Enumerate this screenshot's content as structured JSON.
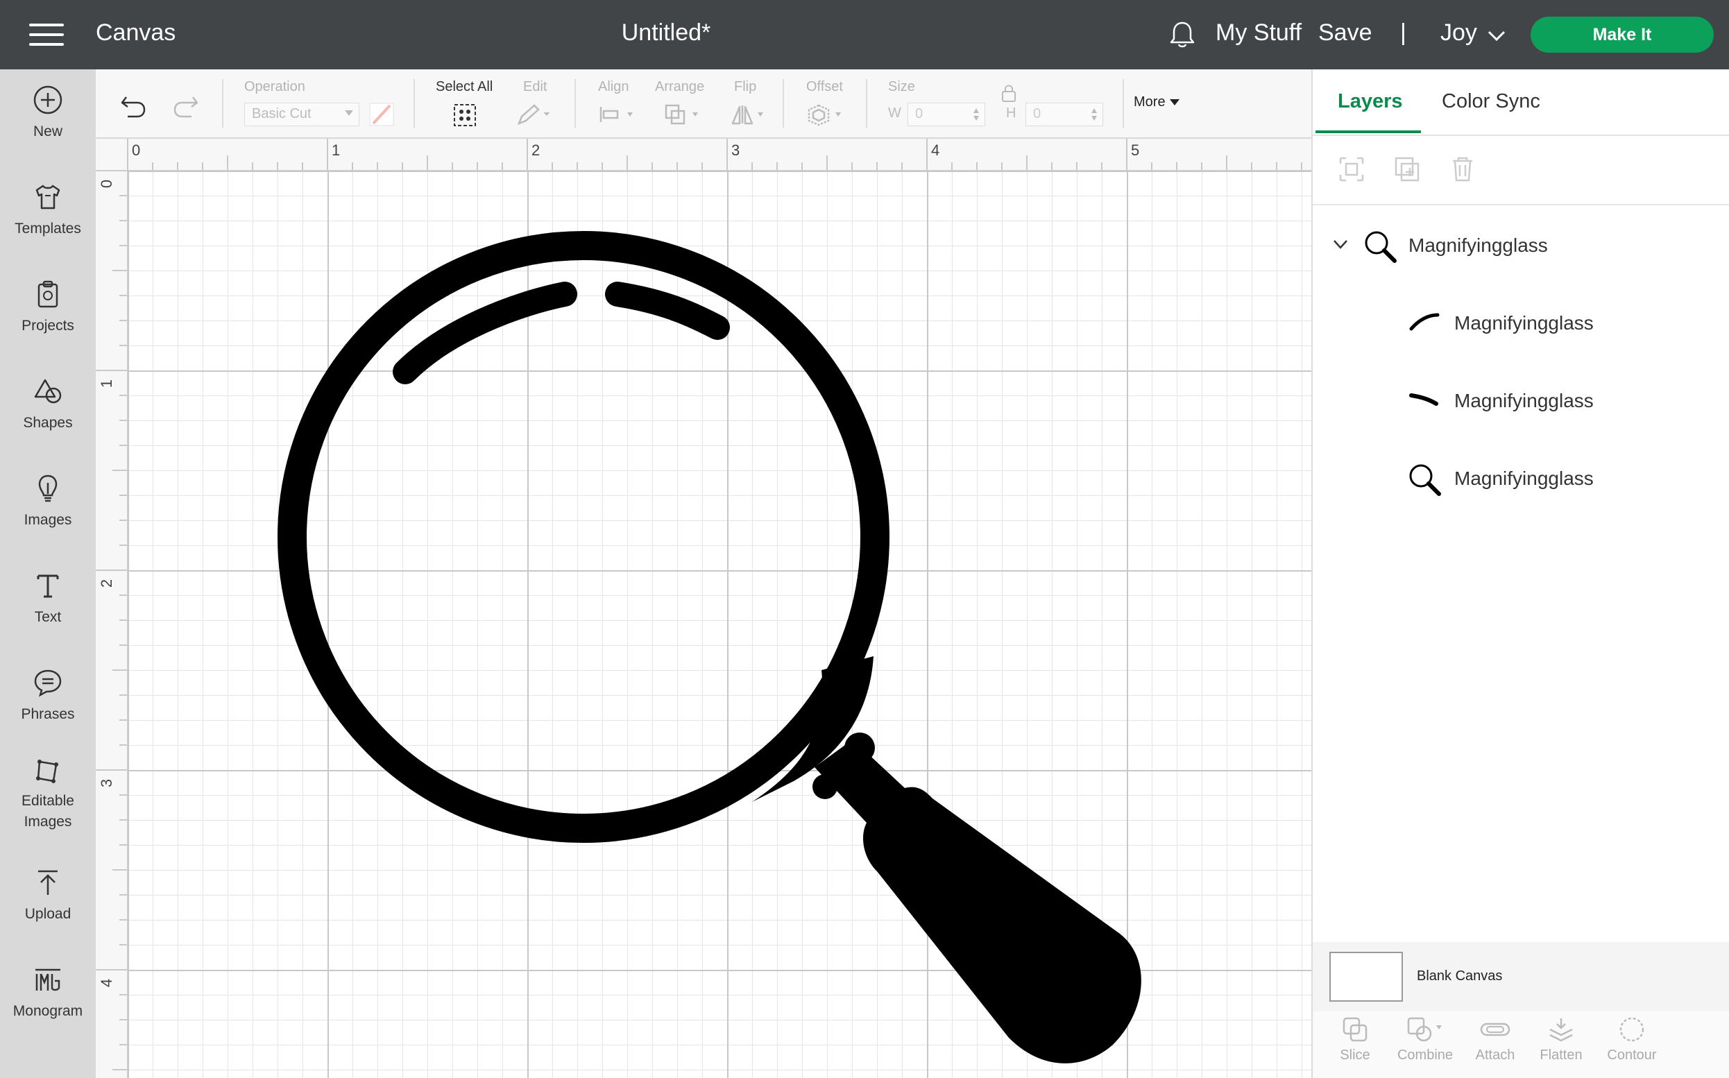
{
  "header": {
    "app_title": "Canvas",
    "document_title": "Untitled*",
    "my_stuff": "My Stuff",
    "save": "Save",
    "divider": "|",
    "user": "Joy",
    "make_it": "Make It"
  },
  "sidebar": {
    "items": [
      {
        "label": "New",
        "icon": "plus-circle-icon"
      },
      {
        "label": "Templates",
        "icon": "tshirt-icon"
      },
      {
        "label": "Projects",
        "icon": "clipboard-icon"
      },
      {
        "label": "Shapes",
        "icon": "shapes-icon"
      },
      {
        "label": "Images",
        "icon": "lightbulb-icon"
      },
      {
        "label": "Text",
        "icon": "text-t-icon"
      },
      {
        "label": "Phrases",
        "icon": "speech-bubble-icon"
      },
      {
        "label": "Editable\nImages",
        "label_line1": "Editable",
        "label_line2": "Images",
        "icon": "editable-images-icon"
      },
      {
        "label": "Upload",
        "icon": "upload-arrow-icon"
      },
      {
        "label": "Monogram",
        "icon": "monogram-icon"
      }
    ]
  },
  "toolbar": {
    "operation_label": "Operation",
    "operation_value": "Basic Cut",
    "select_all": "Select All",
    "edit": "Edit",
    "align": "Align",
    "arrange": "Arrange",
    "flip": "Flip",
    "offset": "Offset",
    "size": "Size",
    "w_label": "W",
    "w_value": "0",
    "h_label": "H",
    "h_value": "0",
    "more": "More"
  },
  "rulers": {
    "top": [
      "0",
      "1",
      "2",
      "3",
      "4",
      "5"
    ],
    "left": [
      "0",
      "1",
      "2",
      "3",
      "4"
    ]
  },
  "panel": {
    "tabs": [
      "Layers",
      "Color Sync"
    ],
    "active_tab": "Layers",
    "group_name": "Magnifyingglass",
    "layers": [
      {
        "name": "Magnifyingglass",
        "icon": "arc-left-icon"
      },
      {
        "name": "Magnifyingglass",
        "icon": "arc-right-icon"
      },
      {
        "name": "Magnifyingglass",
        "icon": "magnifying-glass-icon"
      }
    ],
    "blank_canvas": "Blank Canvas",
    "bottom_tools": [
      "Slice",
      "Combine",
      "Attach",
      "Flatten",
      "Contour"
    ]
  },
  "colors": {
    "header_bg": "#414548",
    "accent": "#0ba15a",
    "sidebar_bg": "#d9d9d9"
  }
}
